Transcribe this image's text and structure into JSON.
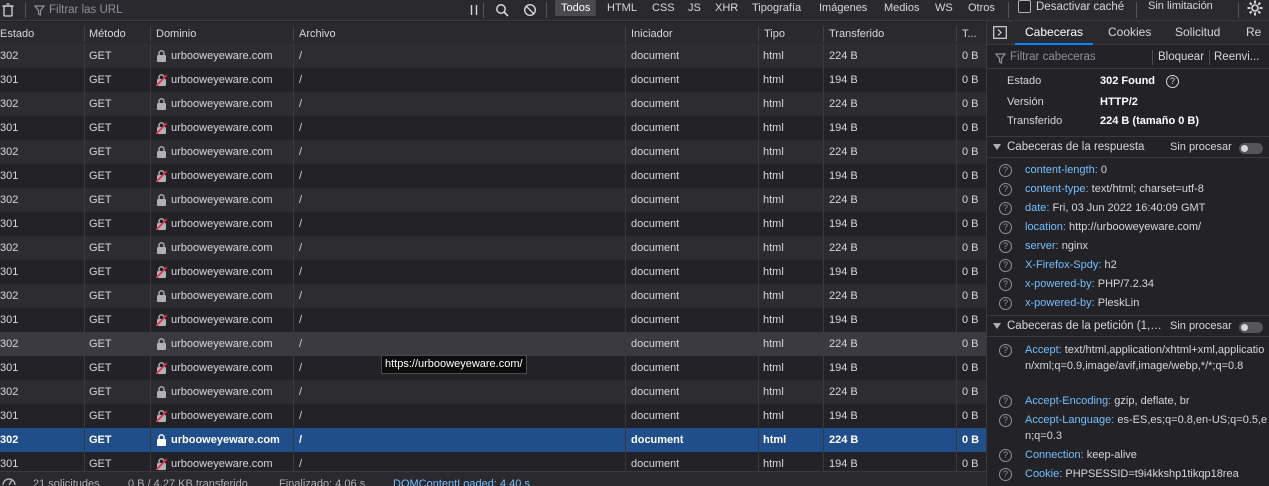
{
  "toolbar": {
    "filter_placeholder": "Filtrar las URL",
    "types": [
      "Todos",
      "HTML",
      "CSS",
      "JS",
      "XHR",
      "Tipografía",
      "Imágenes",
      "Medios",
      "WS",
      "Otros"
    ],
    "disable_cache": "Desactivar caché",
    "throttling": "Sin limitación"
  },
  "table": {
    "columns": [
      "Estado",
      "Método",
      "Dominio",
      "Archivo",
      "Iniciador",
      "Tipo",
      "Transferido",
      "T..."
    ],
    "rows": [
      {
        "status": "302",
        "method": "GET",
        "domain": "urbooweyeware.com",
        "secure": true,
        "file": "/",
        "initiator": "document",
        "type": "html",
        "transferred": "224 B",
        "size": "0 B"
      },
      {
        "status": "301",
        "method": "GET",
        "domain": "urbooweyeware.com",
        "secure": false,
        "file": "/",
        "initiator": "document",
        "type": "html",
        "transferred": "194 B",
        "size": "0 B"
      },
      {
        "status": "302",
        "method": "GET",
        "domain": "urbooweyeware.com",
        "secure": true,
        "file": "/",
        "initiator": "document",
        "type": "html",
        "transferred": "224 B",
        "size": "0 B"
      },
      {
        "status": "301",
        "method": "GET",
        "domain": "urbooweyeware.com",
        "secure": false,
        "file": "/",
        "initiator": "document",
        "type": "html",
        "transferred": "194 B",
        "size": "0 B"
      },
      {
        "status": "302",
        "method": "GET",
        "domain": "urbooweyeware.com",
        "secure": true,
        "file": "/",
        "initiator": "document",
        "type": "html",
        "transferred": "224 B",
        "size": "0 B"
      },
      {
        "status": "301",
        "method": "GET",
        "domain": "urbooweyeware.com",
        "secure": false,
        "file": "/",
        "initiator": "document",
        "type": "html",
        "transferred": "194 B",
        "size": "0 B"
      },
      {
        "status": "302",
        "method": "GET",
        "domain": "urbooweyeware.com",
        "secure": true,
        "file": "/",
        "initiator": "document",
        "type": "html",
        "transferred": "224 B",
        "size": "0 B"
      },
      {
        "status": "301",
        "method": "GET",
        "domain": "urbooweyeware.com",
        "secure": false,
        "file": "/",
        "initiator": "document",
        "type": "html",
        "transferred": "194 B",
        "size": "0 B"
      },
      {
        "status": "302",
        "method": "GET",
        "domain": "urbooweyeware.com",
        "secure": true,
        "file": "/",
        "initiator": "document",
        "type": "html",
        "transferred": "224 B",
        "size": "0 B"
      },
      {
        "status": "301",
        "method": "GET",
        "domain": "urbooweyeware.com",
        "secure": false,
        "file": "/",
        "initiator": "document",
        "type": "html",
        "transferred": "194 B",
        "size": "0 B"
      },
      {
        "status": "302",
        "method": "GET",
        "domain": "urbooweyeware.com",
        "secure": true,
        "file": "/",
        "initiator": "document",
        "type": "html",
        "transferred": "224 B",
        "size": "0 B"
      },
      {
        "status": "301",
        "method": "GET",
        "domain": "urbooweyeware.com",
        "secure": false,
        "file": "/",
        "initiator": "document",
        "type": "html",
        "transferred": "194 B",
        "size": "0 B"
      },
      {
        "status": "302",
        "method": "GET",
        "domain": "urbooweyeware.com",
        "secure": true,
        "file": "/",
        "initiator": "document",
        "type": "html",
        "transferred": "224 B",
        "size": "0 B"
      },
      {
        "status": "301",
        "method": "GET",
        "domain": "urbooweyeware.com",
        "secure": false,
        "file": "/",
        "initiator": "document",
        "type": "html",
        "transferred": "194 B",
        "size": "0 B"
      },
      {
        "status": "302",
        "method": "GET",
        "domain": "urbooweyeware.com",
        "secure": true,
        "file": "/",
        "initiator": "document",
        "type": "html",
        "transferred": "224 B",
        "size": "0 B"
      },
      {
        "status": "301",
        "method": "GET",
        "domain": "urbooweyeware.com",
        "secure": false,
        "file": "/",
        "initiator": "document",
        "type": "html",
        "transferred": "194 B",
        "size": "0 B"
      },
      {
        "status": "302",
        "method": "GET",
        "domain": "urbooweyeware.com",
        "secure": true,
        "file": "/",
        "initiator": "document",
        "type": "html",
        "transferred": "224 B",
        "size": "0 B"
      },
      {
        "status": "301",
        "method": "GET",
        "domain": "urbooweyeware.com",
        "secure": false,
        "file": "/",
        "initiator": "document",
        "type": "html",
        "transferred": "194 B",
        "size": "0 B"
      }
    ],
    "hover_row": 12,
    "selected_row": 16
  },
  "tooltip": "https://urbooweyeware.com/",
  "statusbar": {
    "requests": "21 solicitudes",
    "transferred": "0 B / 4,27 KB transferido",
    "finished": "Finalizado: 4,06 s",
    "dcl": "DOMContentLoaded: 4,40 s"
  },
  "panel": {
    "tabs": [
      "Cabeceras",
      "Cookies",
      "Solicitud",
      "Re"
    ],
    "filter_placeholder": "Filtrar cabeceras",
    "block": "Bloquear",
    "resend": "Reenvi...",
    "summary": [
      {
        "key": "Estado",
        "value": "302 Found"
      },
      {
        "key": "Versión",
        "value": "HTTP/2"
      },
      {
        "key": "Transferido",
        "value": "224 B (tamaño 0 B)"
      }
    ],
    "response_section": "Cabeceras de la respuesta",
    "request_section": "Cabeceras de la petición (1,1 kB)",
    "raw_label": "Sin procesar",
    "response_headers": [
      {
        "name": "content-length:",
        "value": "0"
      },
      {
        "name": "content-type:",
        "value": "text/html; charset=utf-8"
      },
      {
        "name": "date:",
        "value": "Fri, 03 Jun 2022 16:40:09 GMT"
      },
      {
        "name": "location:",
        "value": "http://urbooweyeware.com/"
      },
      {
        "name": "server:",
        "value": "nginx"
      },
      {
        "name": "X-Firefox-Spdy:",
        "value": "h2"
      },
      {
        "name": "x-powered-by:",
        "value": "PHP/7.2.34"
      },
      {
        "name": "x-powered-by:",
        "value": "PleskLin"
      }
    ],
    "request_headers": [
      {
        "name": "Accept:",
        "value": "text/html,application/xhtml+xml,application/xml;q=0.9,image/avif,image/webp,*/*;q=0.8"
      },
      {
        "name": "Accept-Encoding:",
        "value": "gzip, deflate, br"
      },
      {
        "name": "Accept-Language:",
        "value": "es-ES,es;q=0.8,en-US;q=0.5,en;q=0.3"
      },
      {
        "name": "Connection:",
        "value": "keep-alive"
      },
      {
        "name": "Cookie:",
        "value": "PHPSESSID=t9i4kkshp1tikqp18rea"
      }
    ]
  }
}
